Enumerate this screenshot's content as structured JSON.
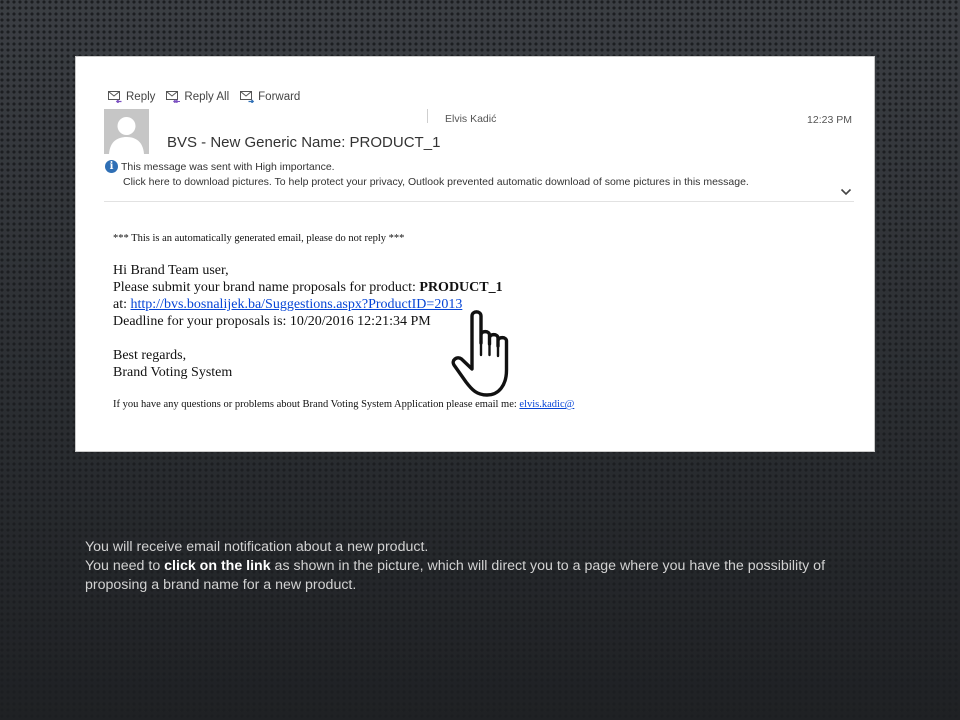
{
  "toolbar": {
    "reply_label": "Reply",
    "reply_all_label": "Reply All",
    "forward_label": "Forward"
  },
  "email": {
    "sender": "Elvis Kadić",
    "time": "12:23 PM",
    "subject": "BVS - New Generic Name: PRODUCT_1",
    "importance_note": "This message was sent with High importance.",
    "download_note": "Click here to download pictures. To help protect your privacy, Outlook prevented automatic download of some pictures in this message.",
    "body": {
      "auto_note": "*** This is an automatically generated email, please do not reply ***",
      "greeting": "Hi Brand Team user,",
      "submit_text": "Please submit your brand name proposals for product: ",
      "product": "PRODUCT_1",
      "at_label": "at: ",
      "link": "http://bvs.bosnalijek.ba/Suggestions.aspx?ProductID=2013",
      "deadline": "Deadline for your proposals is: 10/20/2016 12:21:34 PM",
      "regards": "Best regards,",
      "signature": "Brand Voting System",
      "contact_text": "If you have any questions or problems about Brand Voting System Application please email me: ",
      "contact_email": "elvis.kadic@"
    }
  },
  "caption": {
    "line1": "You will receive email notification about a new product.",
    "line2_before": "You need to ",
    "line2_bold": "click on the link",
    "line2_after": " as shown in the picture, which will direct you to a page where you have the possibility of proposing a brand name for a new product."
  },
  "icons": {
    "reply": "reply-icon",
    "reply_all": "reply-all-icon",
    "forward": "forward-icon",
    "avatar": "user-silhouette",
    "info": "info-icon",
    "chevron": "chevron-down-icon",
    "cursor": "hand-pointer-icon"
  },
  "colors": {
    "link": "#0645d6",
    "info": "#2f6fb5",
    "caption_text": "#d2d2d2"
  }
}
